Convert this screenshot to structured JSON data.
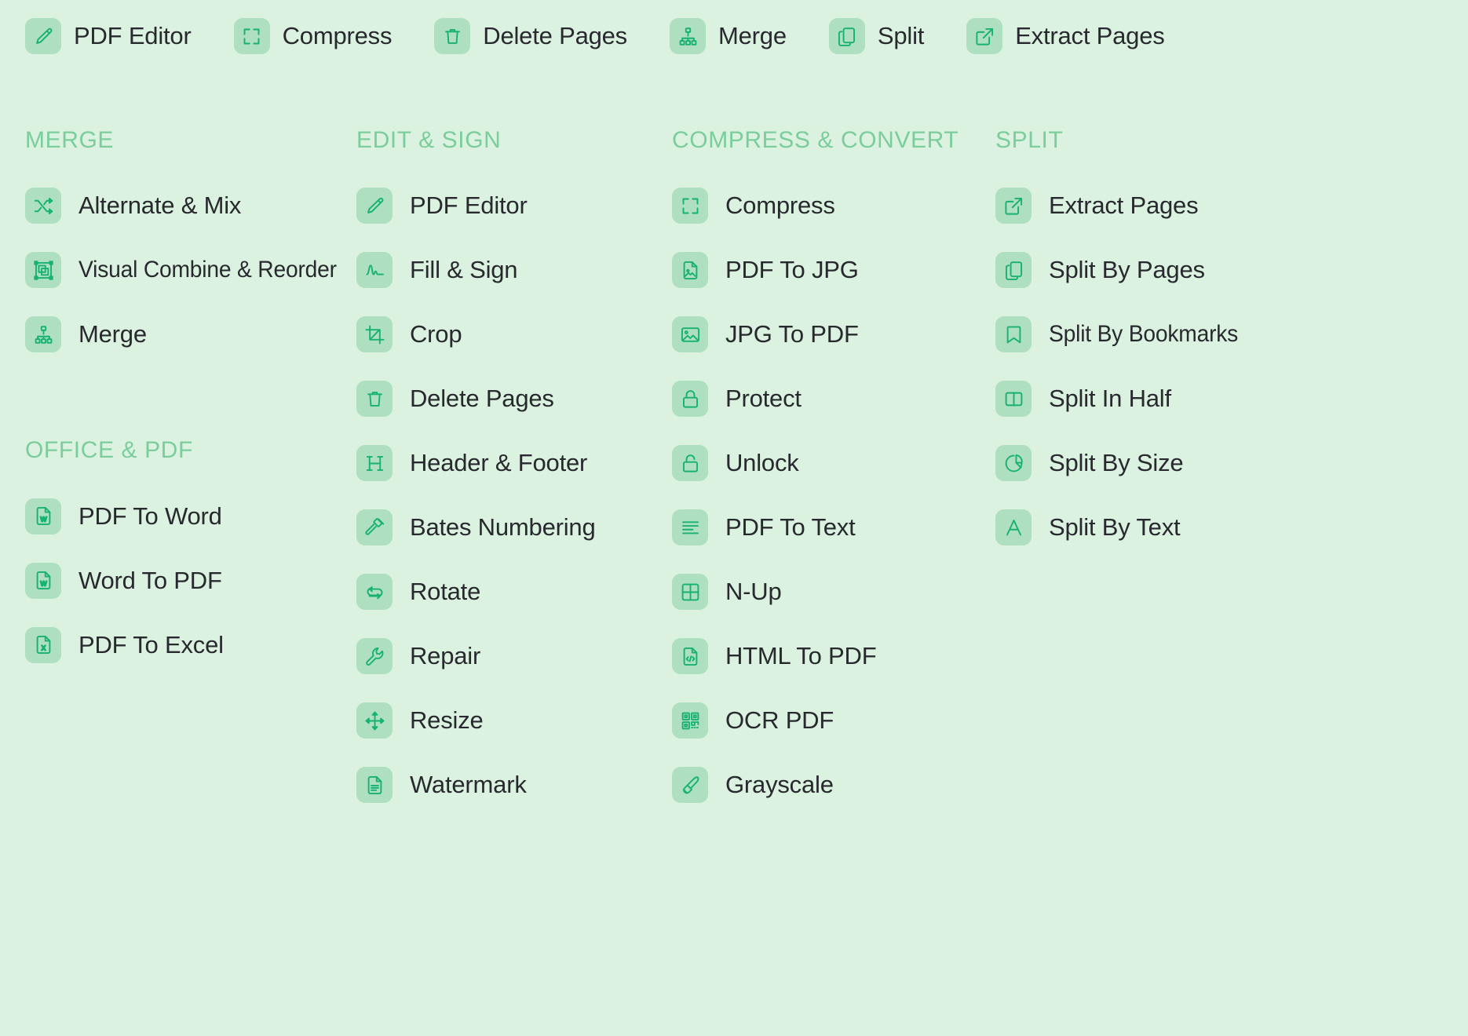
{
  "theme": {
    "page_background": "#dcf2e0",
    "tile_background": "#addfc0",
    "icon_color": "#17b173",
    "group_title_color": "#7bcd9c",
    "label_color": "#27292e"
  },
  "quickbar": {
    "items": [
      {
        "label": "PDF Editor",
        "icon": "pencil-icon"
      },
      {
        "label": "Compress",
        "icon": "compress-icon"
      },
      {
        "label": "Delete Pages",
        "icon": "trash-icon"
      },
      {
        "label": "Merge",
        "icon": "merge-tree-icon"
      },
      {
        "label": "Split",
        "icon": "copy-pages-icon"
      },
      {
        "label": "Extract Pages",
        "icon": "extract-arrow-icon"
      }
    ]
  },
  "columns": [
    {
      "groups": [
        {
          "title": "MERGE",
          "items": [
            {
              "label": "Alternate & Mix",
              "icon": "shuffle-icon"
            },
            {
              "label": "Visual Combine & Reorder",
              "icon": "visual-combine-icon"
            },
            {
              "label": "Merge",
              "icon": "merge-tree-icon"
            }
          ]
        },
        {
          "title": "OFFICE & PDF",
          "items": [
            {
              "label": "PDF To Word",
              "icon": "word-file-icon"
            },
            {
              "label": "Word To PDF",
              "icon": "word-file-icon"
            },
            {
              "label": "PDF To Excel",
              "icon": "excel-file-icon"
            }
          ]
        }
      ]
    },
    {
      "groups": [
        {
          "title": "EDIT & SIGN",
          "items": [
            {
              "label": "PDF Editor",
              "icon": "pencil-icon"
            },
            {
              "label": "Fill & Sign",
              "icon": "signature-icon"
            },
            {
              "label": "Crop",
              "icon": "crop-icon"
            },
            {
              "label": "Delete Pages",
              "icon": "trash-icon"
            },
            {
              "label": "Header & Footer",
              "icon": "letter-h-icon"
            },
            {
              "label": "Bates Numbering",
              "icon": "gavel-icon"
            },
            {
              "label": "Rotate",
              "icon": "rotate-icon"
            },
            {
              "label": "Repair",
              "icon": "wrench-icon"
            },
            {
              "label": "Resize",
              "icon": "resize-arrows-icon"
            },
            {
              "label": "Watermark",
              "icon": "document-lines-icon"
            }
          ]
        }
      ]
    },
    {
      "groups": [
        {
          "title": "COMPRESS & CONVERT",
          "items": [
            {
              "label": "Compress",
              "icon": "compress-icon"
            },
            {
              "label": "PDF To JPG",
              "icon": "image-file-icon"
            },
            {
              "label": "JPG To PDF",
              "icon": "photo-icon"
            },
            {
              "label": "Protect",
              "icon": "lock-closed-icon"
            },
            {
              "label": "Unlock",
              "icon": "lock-open-icon"
            },
            {
              "label": "PDF To Text",
              "icon": "text-lines-icon"
            },
            {
              "label": "N-Up",
              "icon": "grid-four-icon"
            },
            {
              "label": "HTML To PDF",
              "icon": "code-file-icon"
            },
            {
              "label": "OCR PDF",
              "icon": "qr-scan-icon"
            },
            {
              "label": "Grayscale",
              "icon": "paintbrush-icon"
            }
          ]
        }
      ]
    },
    {
      "groups": [
        {
          "title": "SPLIT",
          "items": [
            {
              "label": "Extract Pages",
              "icon": "extract-arrow-icon"
            },
            {
              "label": "Split By Pages",
              "icon": "copy-pages-icon"
            },
            {
              "label": "Split By Bookmarks",
              "icon": "bookmark-icon"
            },
            {
              "label": "Split In Half",
              "icon": "split-half-icon"
            },
            {
              "label": "Split By Size",
              "icon": "pie-chart-icon"
            },
            {
              "label": "Split By Text",
              "icon": "letter-a-icon"
            }
          ]
        }
      ]
    }
  ]
}
